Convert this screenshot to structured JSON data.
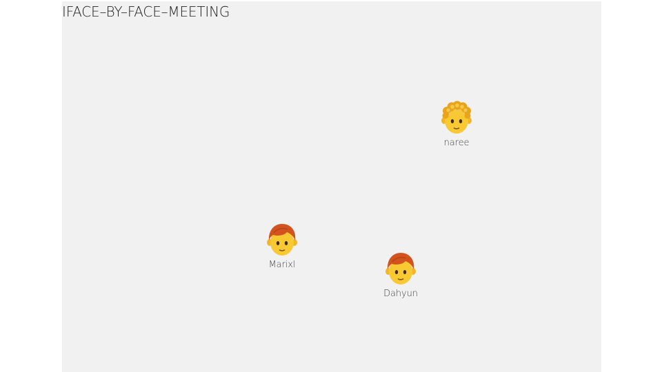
{
  "title": "IFACE–BY–FACE–MEETING",
  "participants": [
    {
      "name": "naree",
      "avatar": "person-curly-hair-icon"
    },
    {
      "name": "Marixl",
      "avatar": "person-red-hair-icon"
    },
    {
      "name": "Dahyun",
      "avatar": "person-red-hair-icon"
    }
  ],
  "colors": {
    "canvas": "#f1f1f1",
    "skin": "#f9c934",
    "red_hair": "#d3531e",
    "curly_hair": "#f0b423"
  }
}
